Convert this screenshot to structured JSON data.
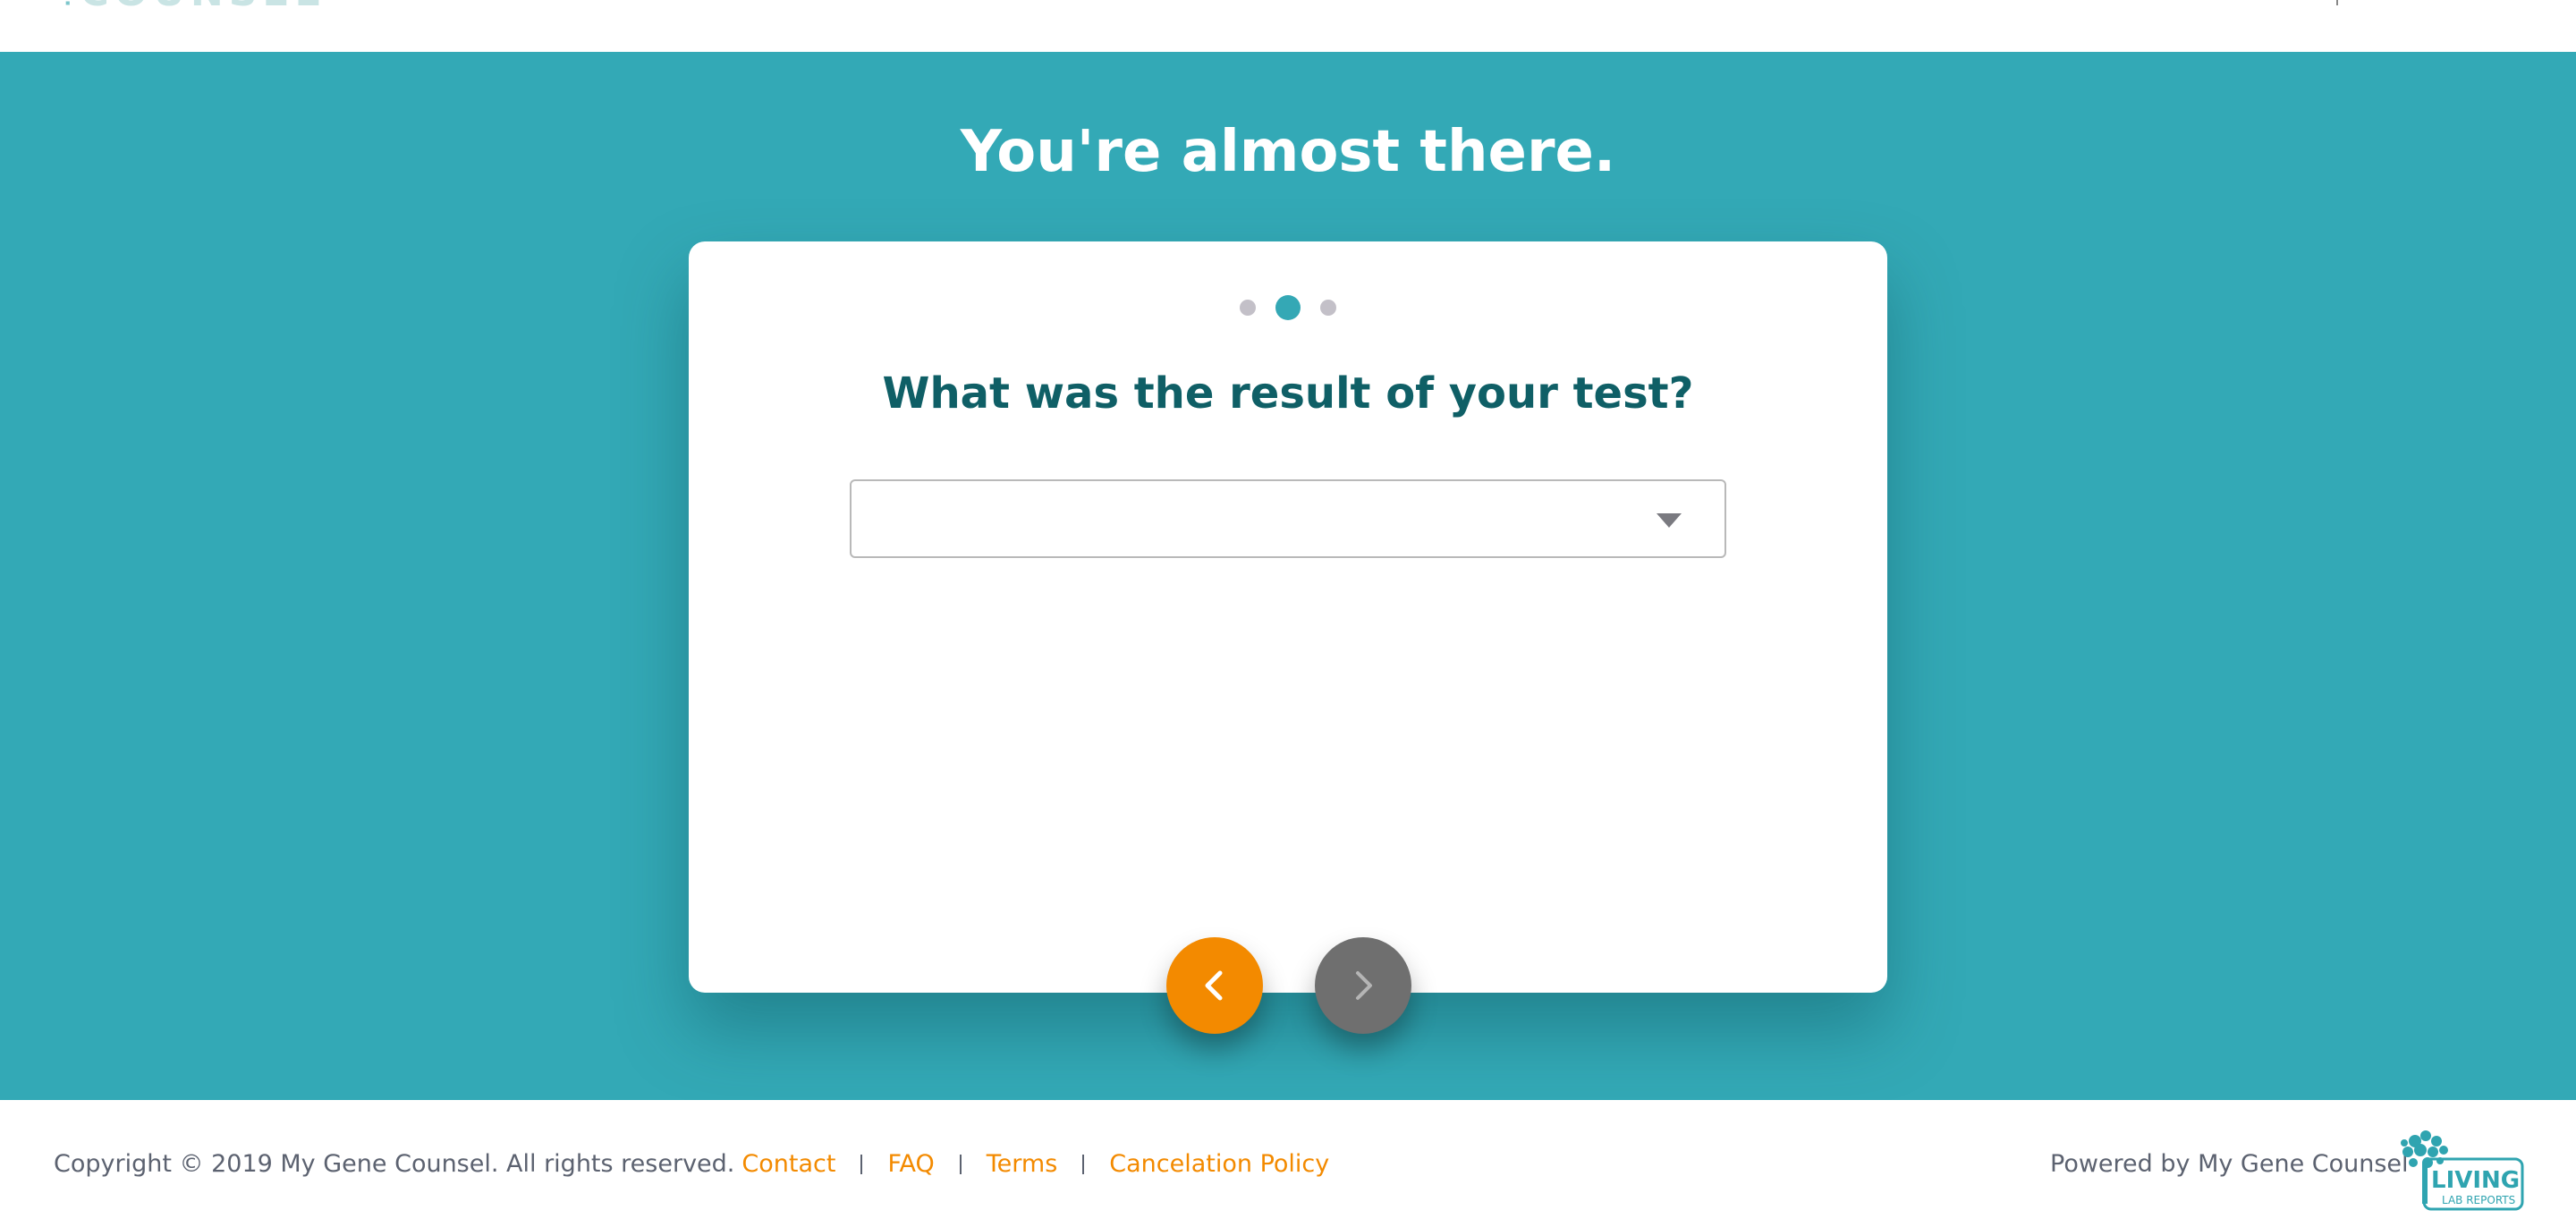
{
  "header": {
    "logo_text": "COUNSEL"
  },
  "hero": {
    "title": "You're almost there."
  },
  "card": {
    "steps": [
      {
        "label": "step-1",
        "active": false
      },
      {
        "label": "step-2",
        "active": true
      },
      {
        "label": "step-3",
        "active": false
      }
    ],
    "question": "What was the result of your test?",
    "select": {
      "value": "",
      "icon": "chevron-down-icon"
    },
    "prev_icon": "chevron-left-icon",
    "next_icon": "chevron-right-icon"
  },
  "footer": {
    "copyright": "Copyright © 2019 My Gene Counsel. All rights reserved.",
    "links": [
      "Contact",
      "FAQ",
      "Terms",
      "Cancelation Policy"
    ],
    "powered_by": "Powered by My Gene Counsel",
    "partner_logo_text": "LIVING LAB REPORTS"
  },
  "colors": {
    "brand_teal": "#33a9b6",
    "heading_teal": "#0f5f66",
    "accent_orange": "#f38a00",
    "disabled_gray": "#6f6f6f"
  }
}
